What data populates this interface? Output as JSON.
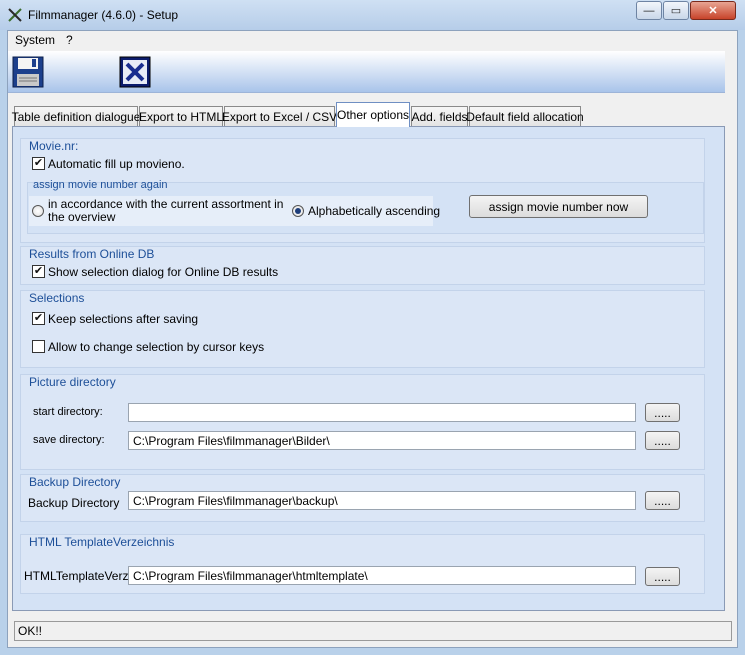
{
  "window": {
    "title": "Filmmanager (4.6.0) - Setup",
    "minimize": "—",
    "maximize": "▭",
    "close": "✕"
  },
  "menu": {
    "system": "System",
    "help": "?"
  },
  "toolbar": {
    "save_icon": "floppy-disk-icon",
    "close_icon": "close-x-icon"
  },
  "tabs": [
    {
      "label": "Table definition dialogue"
    },
    {
      "label": "Export to HTML"
    },
    {
      "label": "Export to Excel / CSV"
    },
    {
      "label": "Other options"
    },
    {
      "label": "Add. fields"
    },
    {
      "label": "Default field allocation"
    }
  ],
  "movie_nr": {
    "title": "Movie.nr:",
    "auto_fill_label": "Automatic fill up movieno.",
    "auto_fill_checked": true,
    "assign_group_title": "assign movie number again",
    "radio_assortment": "in accordance with the current assortment in the overview",
    "radio_alpha": "Alphabetically ascending",
    "assign_button": "assign movie number now"
  },
  "online_db": {
    "title": "Results from Online DB",
    "show_dialog_label": "Show selection dialog for Online DB results",
    "checked": true
  },
  "selections": {
    "title": "Selections",
    "keep_label": "Keep selections after saving",
    "keep_checked": true,
    "cursor_label": "Allow to change selection by cursor keys",
    "cursor_checked": false
  },
  "picture_dir": {
    "title": "Picture directory",
    "start_label": "start directory:",
    "start_value": "",
    "save_label": "save directory:",
    "save_value": "C:\\Program Files\\filmmanager\\Bilder\\",
    "browse": "....."
  },
  "backup_dir": {
    "title": "Backup Directory",
    "label": "Backup Directory",
    "value": "C:\\Program Files\\filmmanager\\backup\\",
    "browse": "....."
  },
  "html_dir": {
    "title": "HTML TemplateVerzeichnis",
    "label": "HTMLTemplateVerz:",
    "value": "C:\\Program Files\\filmmanager\\htmltemplate\\",
    "browse": "....."
  },
  "status": {
    "text": "OK!!"
  }
}
